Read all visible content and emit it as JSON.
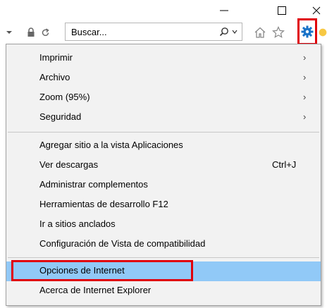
{
  "window": {
    "minimize_glyph": "—",
    "maximize_glyph": "☐",
    "close_glyph": "✕"
  },
  "toolbar": {
    "search": {
      "placeholder": "Buscar..."
    },
    "icons": [
      "lock-icon",
      "refresh-icon",
      "search-icon",
      "chevron-down-icon",
      "home-icon",
      "star-icon",
      "gear-icon",
      "smiley-icon"
    ]
  },
  "menu": {
    "items": [
      {
        "label": "Imprimir",
        "submenu": true
      },
      {
        "label": "Archivo",
        "submenu": true
      },
      {
        "label": "Zoom (95%)",
        "submenu": true
      },
      {
        "label": "Seguridad",
        "submenu": true
      },
      {
        "label": "Agregar sitio a la vista Aplicaciones"
      },
      {
        "label": "Ver descargas",
        "shortcut": "Ctrl+J"
      },
      {
        "label": "Administrar complementos"
      },
      {
        "label": "Herramientas de desarrollo F12"
      },
      {
        "label": "Ir a sitios anclados"
      },
      {
        "label": "Configuración de Vista de compatibilidad"
      },
      {
        "label": "Opciones de Internet",
        "selected": true
      },
      {
        "label": "Acerca de Internet Explorer"
      }
    ],
    "arrow_glyph": "›"
  },
  "colors": {
    "highlight_red": "#e0000b",
    "selected_blue": "#91c9f7",
    "gear_blue": "#1a73c8"
  }
}
